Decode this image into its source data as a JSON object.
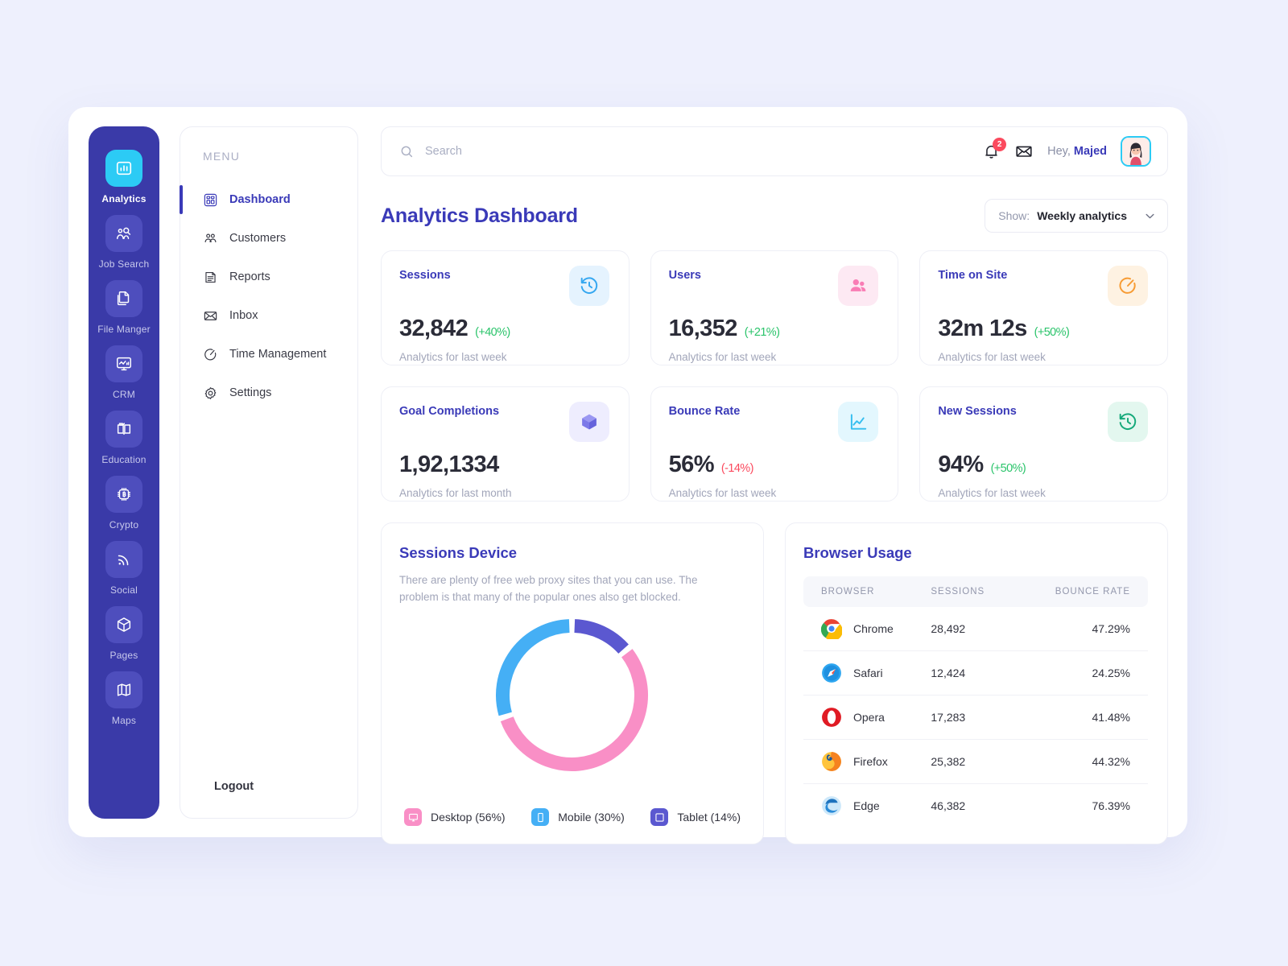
{
  "rail": {
    "items": [
      {
        "label": "Analytics",
        "icon": "bar-chart-icon",
        "active": true
      },
      {
        "label": "Job Search",
        "icon": "job-search-icon",
        "active": false
      },
      {
        "label": "File Manger",
        "icon": "file-manager-icon",
        "active": false
      },
      {
        "label": "CRM",
        "icon": "monitor-chart-icon",
        "active": false
      },
      {
        "label": "Education",
        "icon": "education-icon",
        "active": false
      },
      {
        "label": "Crypto",
        "icon": "chip-bitcoin-icon",
        "active": false
      },
      {
        "label": "Social",
        "icon": "rss-icon",
        "active": false
      },
      {
        "label": "Pages",
        "icon": "cube-icon",
        "active": false
      },
      {
        "label": "Maps",
        "icon": "map-icon",
        "active": false
      }
    ]
  },
  "menu": {
    "title": "MENU",
    "items": [
      {
        "label": "Dashboard",
        "icon": "dashboard-grid-icon",
        "active": true
      },
      {
        "label": "Customers",
        "icon": "customers-icon",
        "active": false
      },
      {
        "label": "Reports",
        "icon": "report-doc-icon",
        "active": false
      },
      {
        "label": "Inbox",
        "icon": "envelope-icon",
        "active": false
      },
      {
        "label": "Time Management",
        "icon": "stopwatch-icon",
        "active": false
      },
      {
        "label": "Settings",
        "icon": "gear-icon",
        "active": false
      }
    ],
    "logout": {
      "label": "Logout",
      "icon": "logout-icon"
    }
  },
  "header": {
    "search_placeholder": "Search",
    "search_value": "",
    "notification_count": "2",
    "greeting_prefix": "Hey, ",
    "user_name": "Majed"
  },
  "page": {
    "title": "Analytics Dashboard",
    "filter_label": "Show:",
    "filter_value": "Weekly analytics"
  },
  "stats": [
    {
      "name": "Sessions",
      "value": "32,842",
      "delta": "(+40%)",
      "dir": "up",
      "sub": "Analytics for last week",
      "icon": "history-clock-icon",
      "icon_bg": "#E5F3FE",
      "icon_color": "#35A7F0"
    },
    {
      "name": "Users",
      "value": "16,352",
      "delta": "(+21%)",
      "dir": "up",
      "sub": "Analytics for last week",
      "icon": "people-icon",
      "icon_bg": "#FDE9F3",
      "icon_color": "#F97CB5"
    },
    {
      "name": "Time on Site",
      "value": "32m 12s",
      "delta": "(+50%)",
      "dir": "up",
      "sub": "Analytics for last week",
      "icon": "timer-icon",
      "icon_bg": "#FEF2E2",
      "icon_color": "#F79B33"
    },
    {
      "name": "Goal Completions",
      "value": "1,92,1334",
      "delta": "",
      "dir": "none",
      "sub": "Analytics for last month",
      "icon": "cube-3d-icon",
      "icon_bg": "#EEEDFE",
      "icon_color": "#7B78E8"
    },
    {
      "name": "Bounce Rate",
      "value": "56%",
      "delta": "(-14%)",
      "dir": "down",
      "sub": "Analytics for last week",
      "icon": "line-chart-icon",
      "icon_bg": "#E3F7FE",
      "icon_color": "#35BEEF"
    },
    {
      "name": "New Sessions",
      "value": "94%",
      "delta": "(+50%)",
      "dir": "up",
      "sub": "Analytics for last week",
      "icon": "history-clock-icon",
      "icon_bg": "#E3F7EF",
      "icon_color": "#15A97A"
    }
  ],
  "sessions_device": {
    "title": "Sessions Device",
    "description": "There are plenty of free web proxy sites that you can use. The problem is that many of the popular ones also get blocked."
  },
  "browser_usage": {
    "title": "Browser Usage",
    "columns": [
      "BROWSER",
      "SESSIONS",
      "BOUNCE RATE"
    ],
    "rows": [
      {
        "browser": "Chrome",
        "sessions": "28,492",
        "bounce": "47.29%",
        "logo": "chrome-logo-icon"
      },
      {
        "browser": "Safari",
        "sessions": "12,424",
        "bounce": "24.25%",
        "logo": "safari-logo-icon"
      },
      {
        "browser": "Opera",
        "sessions": "17,283",
        "bounce": "41.48%",
        "logo": "opera-logo-icon"
      },
      {
        "browser": "Firefox",
        "sessions": "25,382",
        "bounce": "44.32%",
        "logo": "firefox-logo-icon"
      },
      {
        "browser": "Edge",
        "sessions": "46,382",
        "bounce": "76.39%",
        "logo": "edge-logo-icon"
      }
    ]
  },
  "chart_data": {
    "type": "pie",
    "title": "Sessions Device",
    "categories": [
      "Tablet",
      "Desktop",
      "Mobile"
    ],
    "values": [
      14,
      56,
      30
    ],
    "colors": [
      "#5B58D0",
      "#F98FC6",
      "#45AFF5"
    ],
    "legend": [
      {
        "label": "Desktop (56%)",
        "name": "Desktop",
        "value": 56,
        "color": "#F98FC6",
        "icon": "desktop-icon"
      },
      {
        "label": "Mobile (30%)",
        "name": "Mobile",
        "value": 30,
        "color": "#45AFF5",
        "icon": "mobile-icon"
      },
      {
        "label": "Tablet (14%)",
        "name": "Tablet",
        "value": 14,
        "color": "#5B58D0",
        "icon": "tablet-icon"
      }
    ],
    "legend_position": "bottom",
    "donut": true,
    "start_angle_deg": 0,
    "unit": "%"
  },
  "theme": {
    "brand": "#3A3AB8",
    "rail_bg": "#3A3AA8",
    "accent_cyan": "#2CCBF5",
    "positive": "#2BC46B",
    "negative": "#FB4A5E",
    "page_bg": "#EEF0FD"
  }
}
